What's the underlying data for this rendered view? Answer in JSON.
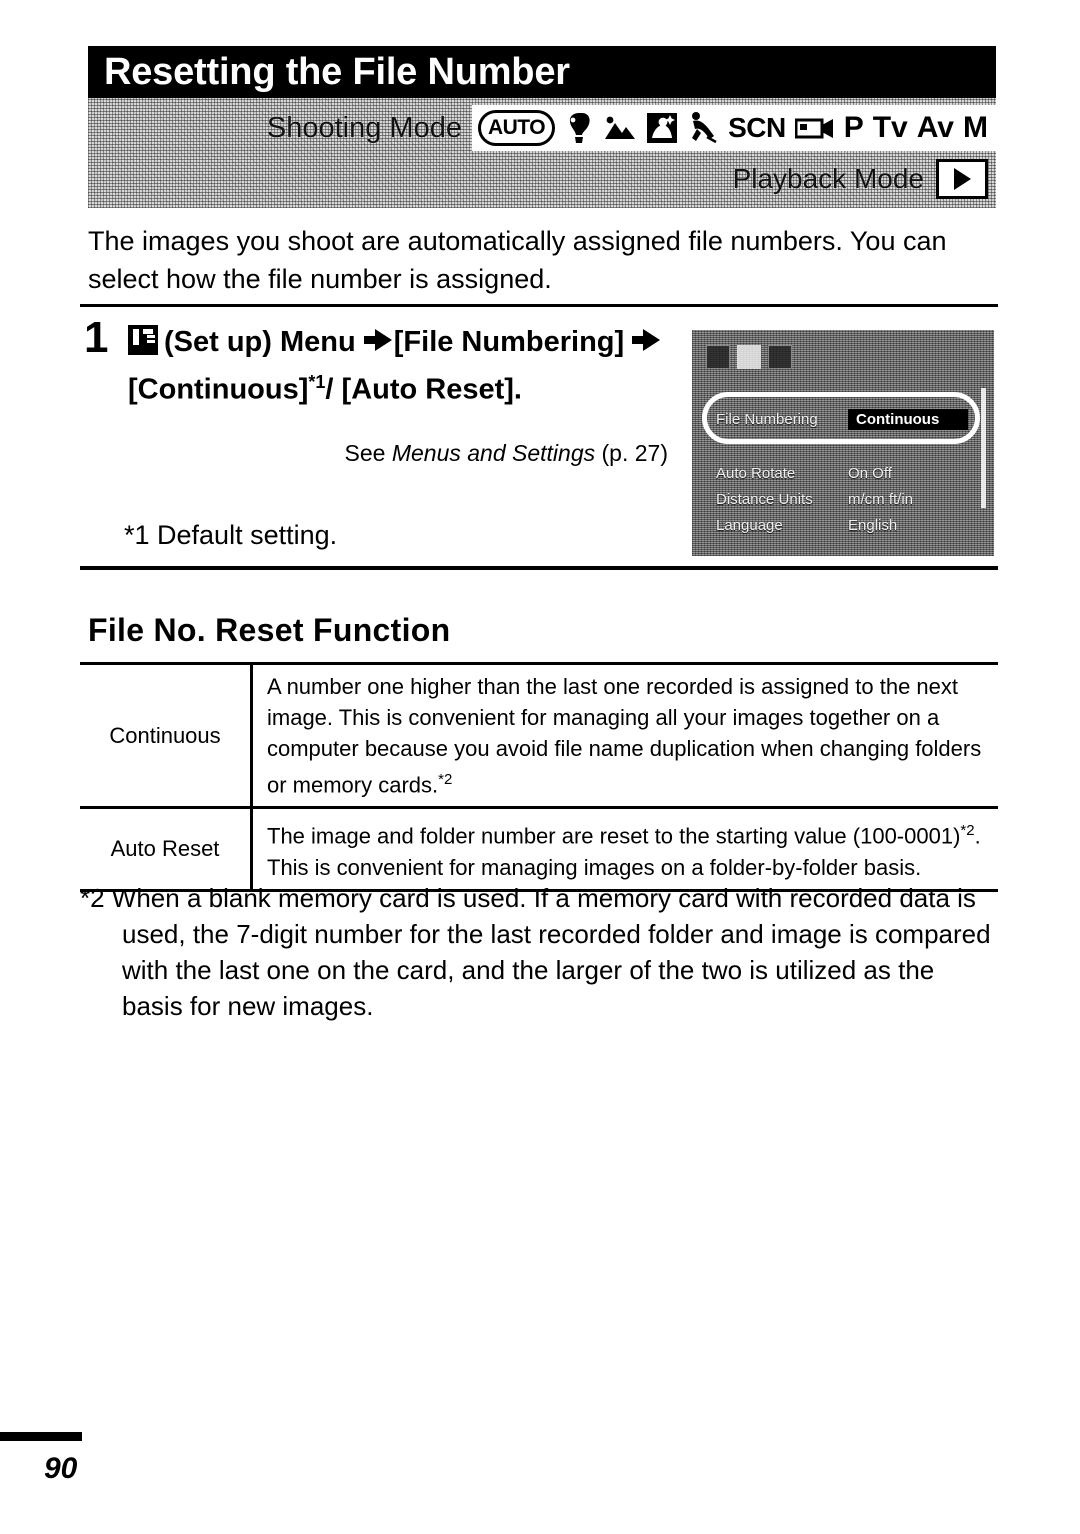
{
  "header": {
    "title": "Resetting the File Number",
    "shooting_mode_label": "Shooting Mode",
    "playback_mode_label": "Playback Mode",
    "playback_icon": "play-triangle-icon",
    "shooting_modes": [
      {
        "name": "auto-mode-icon",
        "label": "AUTO"
      },
      {
        "name": "portrait-mode-icon",
        "label": ""
      },
      {
        "name": "landscape-mode-icon",
        "label": ""
      },
      {
        "name": "night-scene-mode-icon",
        "label": ""
      },
      {
        "name": "kids-and-pets-mode-icon",
        "label": ""
      },
      {
        "name": "scene-mode-icon",
        "label": "SCN"
      },
      {
        "name": "movie-mode-icon",
        "label": ""
      },
      {
        "name": "program-mode-icon",
        "label": "P"
      },
      {
        "name": "shutter-priority-mode-icon",
        "label": "Tv"
      },
      {
        "name": "aperture-priority-mode-icon",
        "label": "Av"
      },
      {
        "name": "manual-mode-icon",
        "label": "M"
      }
    ]
  },
  "intro": {
    "text": "The images you shoot are automatically assigned file numbers. You can select how the file number is assigned."
  },
  "step": {
    "number": "1",
    "setup_icon": "set-up-menu-icon",
    "line_1a": "(Set up) Menu",
    "line_1b": "[File Numbering]",
    "line_1c": "[Continuous]",
    "superscript_1": "*1",
    "slash": "/",
    "line_1d": "[Auto Reset].",
    "see_prefix": "See ",
    "see_italic": "Menus and Settings",
    "see_suffix": " (p. 27)",
    "default_note": "*1 Default setting."
  },
  "lcd": {
    "rows": [
      {
        "label": "File Numbering",
        "value": "Continuous",
        "selected": true
      },
      {
        "label": "Auto Rotate",
        "value": "On  Off",
        "selected": false
      },
      {
        "label": "Distance Units",
        "value": "m/cm  ft/in",
        "selected": false
      },
      {
        "label": "Language",
        "value": "English",
        "selected": false
      }
    ]
  },
  "section": {
    "heading": "File No. Reset Function"
  },
  "table": {
    "rows": [
      {
        "name": "Continuous",
        "description": "A number one higher than the last one recorded is assigned to the next image. This is convenient for managing all your images together on a computer because you avoid file name duplication when changing folders or memory cards.",
        "superscript": "*2",
        "description_tail": ""
      },
      {
        "name": "Auto Reset",
        "description": "The image and folder number are reset to the starting value (100-0001)",
        "superscript": "*2",
        "description_tail": ". This is convenient for managing images on a folder-by-folder basis."
      }
    ]
  },
  "footnote": {
    "text": "*2 When a blank memory card is used. If a memory card with recorded data is used, the 7-digit number for the last recorded folder and image is compared with the last one on the card, and the larger of the two is utilized as the basis for new images."
  },
  "footer": {
    "page_number": "90"
  }
}
